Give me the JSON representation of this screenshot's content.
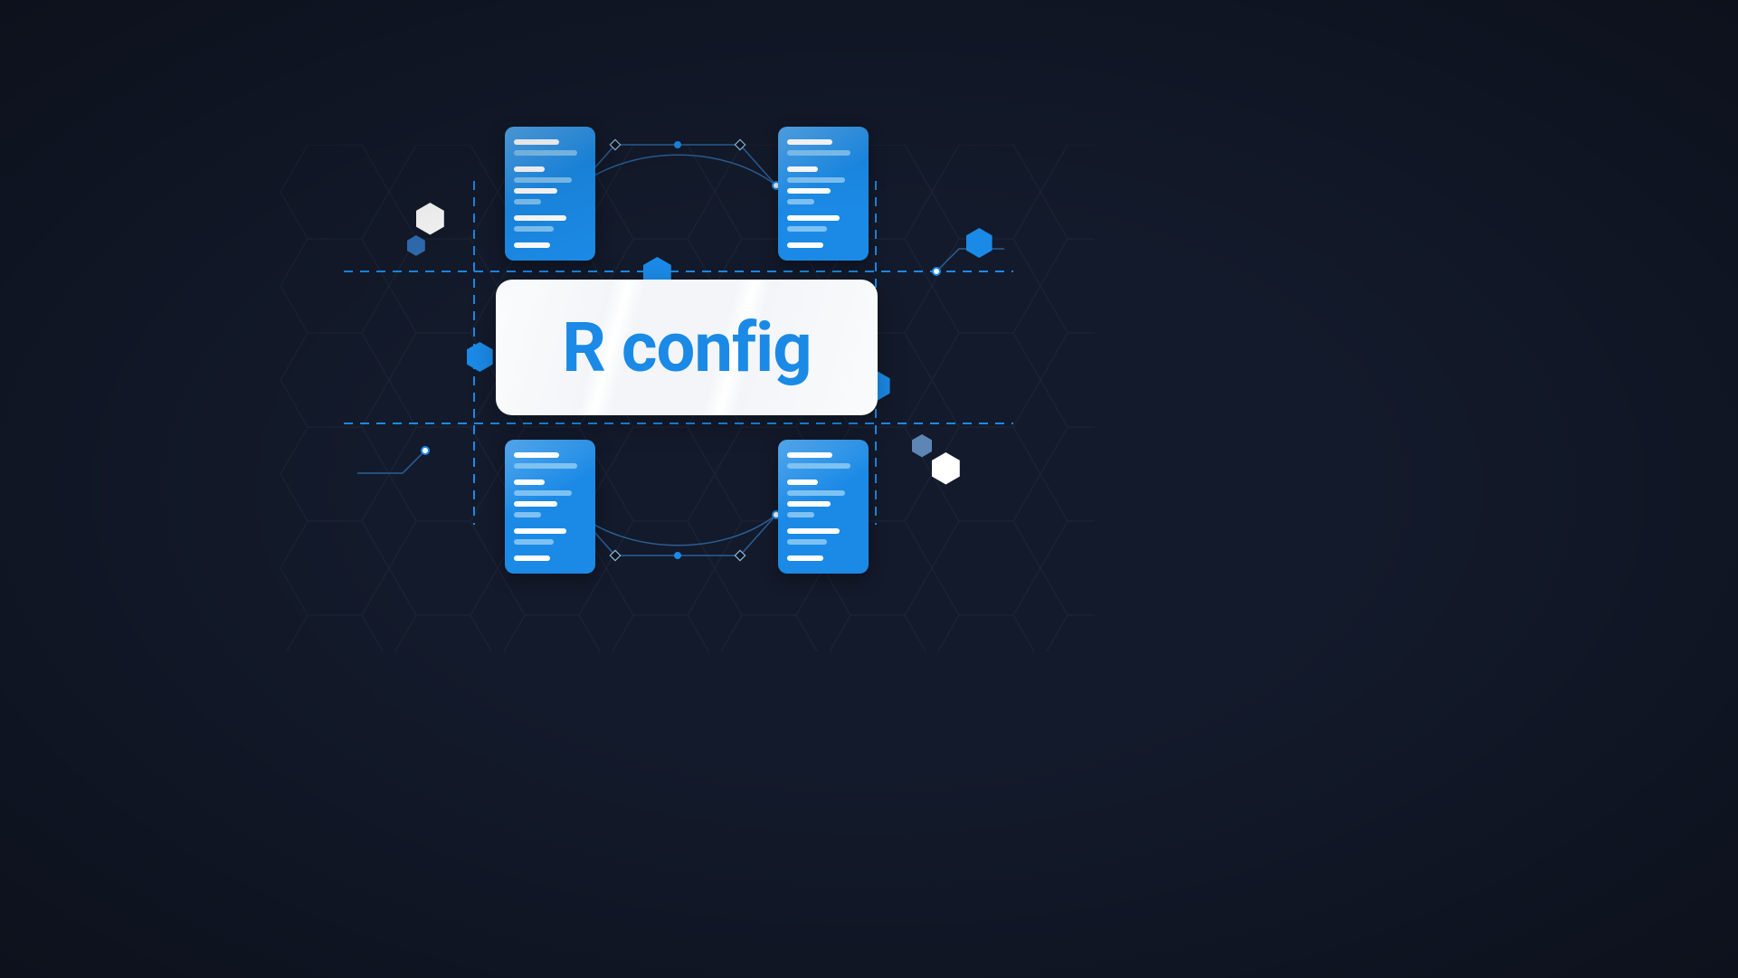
{
  "central": {
    "label": "R config"
  },
  "colors": {
    "background": "#131a2b",
    "accent_blue": "#1b8ae6",
    "card_white": "#f8fafc",
    "hex_white": "#ffffff",
    "hex_blue_mid": "#2f6fb5",
    "dashed_line": "#1b8ae6"
  },
  "decor": {
    "hex_background_pattern": true,
    "dashed_guide_lines": true,
    "bezier_connectors_top": true,
    "bezier_connectors_bottom": true,
    "circuit_trace_top_right": true,
    "circuit_trace_bottom_left": true,
    "floating_hexagons": 6,
    "code_cards": 4
  }
}
